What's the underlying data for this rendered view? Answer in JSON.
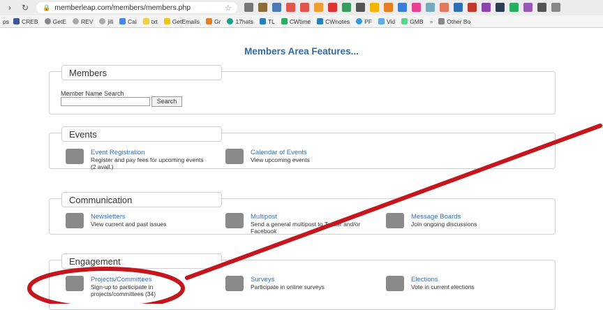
{
  "browser": {
    "url": "memberleap.com/members/members.php",
    "bookmarks": [
      "CREB",
      "GetE",
      "REV",
      "jill",
      "Cal",
      "txt",
      "GetEmails",
      "Gr",
      "17hats",
      "TL",
      "CWtime",
      "CWnotes",
      "PF",
      "Vid",
      "GMB",
      "Other Bo"
    ]
  },
  "page": {
    "title": "Members Area Features..."
  },
  "members": {
    "heading": "Members",
    "search_label": "Member Name Search",
    "search_button": "Search"
  },
  "events": {
    "heading": "Events",
    "items": [
      {
        "title": "Event Registration",
        "desc1": "Register and pay fees for upcoming events",
        "desc2": "(2 avail.)"
      },
      {
        "title": "Calendar of Events",
        "desc1": "View upcoming events",
        "desc2": ""
      }
    ]
  },
  "communication": {
    "heading": "Communication",
    "items": [
      {
        "title": "Newsletters",
        "desc1": "View current and past issues",
        "desc2": ""
      },
      {
        "title": "Multipost",
        "desc1": "Send a general multipost to Twitter and/or",
        "desc2": "Facebook"
      },
      {
        "title": "Message Boards",
        "desc1": "Join ongoing discussions",
        "desc2": ""
      }
    ]
  },
  "engagement": {
    "heading": "Engagement",
    "items": [
      {
        "title": "Projects/Committees",
        "desc1": "Sign-up to participate in",
        "desc2": "projects/committees (34)"
      },
      {
        "title": "Surveys",
        "desc1": "Participate in online surveys",
        "desc2": ""
      },
      {
        "title": "Elections",
        "desc1": "Vote in current elections",
        "desc2": ""
      }
    ]
  },
  "colors": {
    "link": "#3a6fb0",
    "title": "#2e6aa6",
    "annotation": "#c4161c"
  }
}
